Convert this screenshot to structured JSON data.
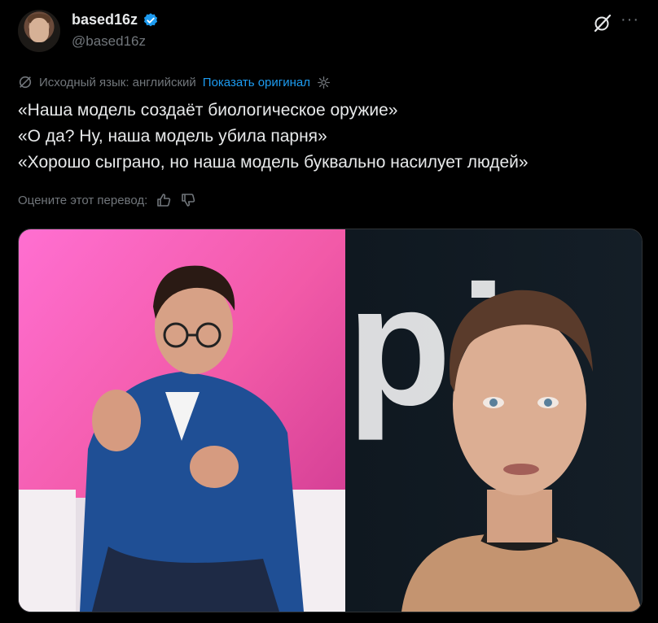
{
  "author": {
    "display_name": "based16z",
    "handle": "@based16z",
    "verified": true
  },
  "translation": {
    "source_language_label": "Исходный язык: английский",
    "show_original_label": "Показать оригинал"
  },
  "tweet": {
    "lines": [
      "«Наша модель создаёт биологическое оружие»",
      "«О да? Ну, наша модель убила парня»",
      "«Хорошо сыграно, но наша модель буквально насилует людей»"
    ]
  },
  "rating": {
    "label": "Оцените этот перевод:"
  },
  "media_text": {
    "backdrop_letters": "pi"
  },
  "icons": {
    "verified": "verified-badge-icon",
    "grok": "grok-icon",
    "more": "more-icon",
    "translate": "translate-icon",
    "settings": "gear-icon",
    "thumbs_up": "thumbs-up-icon",
    "thumbs_down": "thumbs-down-icon"
  },
  "colors": {
    "background": "#000000",
    "text": "#e7e9ea",
    "muted": "#71767b",
    "link": "#1d9bf0",
    "verified": "#1d9bf0"
  }
}
